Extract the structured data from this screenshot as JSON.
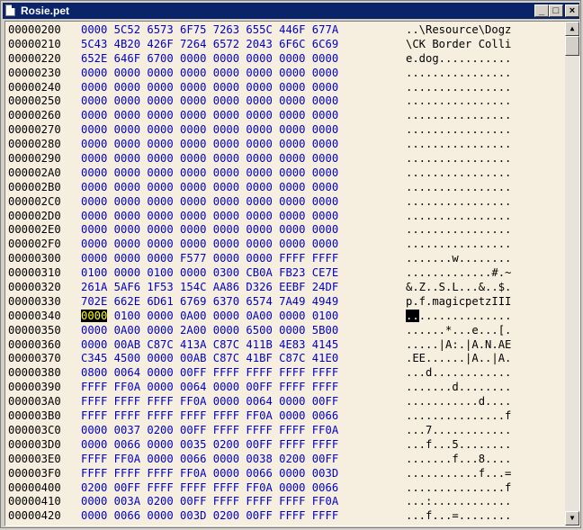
{
  "window": {
    "title": "Rosie.pet"
  },
  "controls": {
    "minimize": "_",
    "maximize": "□",
    "close": "×"
  },
  "scrollbar": {
    "up": "▲",
    "down": "▼"
  },
  "rows": [
    {
      "addr": "00000200",
      "hex": "0000 5C52 6573 6F75 7263 655C 446F 677A",
      "ascii": "..\\Resource\\Dogz"
    },
    {
      "addr": "00000210",
      "hex": "5C43 4B20 426F 7264 6572 2043 6F6C 6C69",
      "ascii": "\\CK Border Colli"
    },
    {
      "addr": "00000220",
      "hex": "652E 646F 6700 0000 0000 0000 0000 0000",
      "ascii": "e.dog..........."
    },
    {
      "addr": "00000230",
      "hex": "0000 0000 0000 0000 0000 0000 0000 0000",
      "ascii": "................"
    },
    {
      "addr": "00000240",
      "hex": "0000 0000 0000 0000 0000 0000 0000 0000",
      "ascii": "................"
    },
    {
      "addr": "00000250",
      "hex": "0000 0000 0000 0000 0000 0000 0000 0000",
      "ascii": "................"
    },
    {
      "addr": "00000260",
      "hex": "0000 0000 0000 0000 0000 0000 0000 0000",
      "ascii": "................"
    },
    {
      "addr": "00000270",
      "hex": "0000 0000 0000 0000 0000 0000 0000 0000",
      "ascii": "................"
    },
    {
      "addr": "00000280",
      "hex": "0000 0000 0000 0000 0000 0000 0000 0000",
      "ascii": "................"
    },
    {
      "addr": "00000290",
      "hex": "0000 0000 0000 0000 0000 0000 0000 0000",
      "ascii": "................"
    },
    {
      "addr": "000002A0",
      "hex": "0000 0000 0000 0000 0000 0000 0000 0000",
      "ascii": "................"
    },
    {
      "addr": "000002B0",
      "hex": "0000 0000 0000 0000 0000 0000 0000 0000",
      "ascii": "................"
    },
    {
      "addr": "000002C0",
      "hex": "0000 0000 0000 0000 0000 0000 0000 0000",
      "ascii": "................"
    },
    {
      "addr": "000002D0",
      "hex": "0000 0000 0000 0000 0000 0000 0000 0000",
      "ascii": "................"
    },
    {
      "addr": "000002E0",
      "hex": "0000 0000 0000 0000 0000 0000 0000 0000",
      "ascii": "................"
    },
    {
      "addr": "000002F0",
      "hex": "0000 0000 0000 0000 0000 0000 0000 0000",
      "ascii": "................"
    },
    {
      "addr": "00000300",
      "hex": "0000 0000 0000 F577 0000 0000 FFFF FFFF",
      "ascii": ".......w........"
    },
    {
      "addr": "00000310",
      "hex": "0100 0000 0100 0000 0300 CB0A FB23 CE7E",
      "ascii": ".............#.~"
    },
    {
      "addr": "00000320",
      "hex": "261A 5AF6 1F53 154C AA86 D326 EEBF 24DF",
      "ascii": "&.Z..S.L...&..$."
    },
    {
      "addr": "00000330",
      "hex": "702E 662E 6D61 6769 6370 6574 7A49 4949",
      "ascii": "p.f.magicpetzIII"
    },
    {
      "addr": "00000340",
      "hexSel": "0000",
      "hex": " 0100 0000 0A00 0000 0A00 0000 0100",
      "asciiSel": "..",
      "ascii": "..............",
      "selected": true
    },
    {
      "addr": "00000350",
      "hex": "0000 0A00 0000 2A00 0000 6500 0000 5B00",
      "ascii": "......*...e...[."
    },
    {
      "addr": "00000360",
      "hex": "0000 00AB C87C 413A C87C 411B 4E83 4145",
      "ascii": ".....|A:.|A.N.AE"
    },
    {
      "addr": "00000370",
      "hex": "C345 4500 0000 00AB C87C 41BF C87C 41E0",
      "ascii": ".EE......|A..|A."
    },
    {
      "addr": "00000380",
      "hex": "0800 0064 0000 00FF FFFF FFFF FFFF FFFF",
      "ascii": "...d............"
    },
    {
      "addr": "00000390",
      "hex": "FFFF FF0A 0000 0064 0000 00FF FFFF FFFF",
      "ascii": ".......d........"
    },
    {
      "addr": "000003A0",
      "hex": "FFFF FFFF FFFF FF0A 0000 0064 0000 00FF",
      "ascii": "...........d...."
    },
    {
      "addr": "000003B0",
      "hex": "FFFF FFFF FFFF FFFF FFFF FF0A 0000 0066",
      "ascii": "...............f"
    },
    {
      "addr": "000003C0",
      "hex": "0000 0037 0200 00FF FFFF FFFF FFFF FF0A",
      "ascii": "...7............"
    },
    {
      "addr": "000003D0",
      "hex": "0000 0066 0000 0035 0200 00FF FFFF FFFF",
      "ascii": "...f...5........"
    },
    {
      "addr": "000003E0",
      "hex": "FFFF FF0A 0000 0066 0000 0038 0200 00FF",
      "ascii": ".......f...8...."
    },
    {
      "addr": "000003F0",
      "hex": "FFFF FFFF FFFF FF0A 0000 0066 0000 003D",
      "ascii": "...........f...="
    },
    {
      "addr": "00000400",
      "hex": "0200 00FF FFFF FFFF FFFF FF0A 0000 0066",
      "ascii": "...............f"
    },
    {
      "addr": "00000410",
      "hex": "0000 003A 0200 00FF FFFF FFFF FFFF FF0A",
      "ascii": "...:............"
    },
    {
      "addr": "00000420",
      "hex": "0000 0066 0000 003D 0200 00FF FFFF FFFF",
      "ascii": "...f...=........"
    }
  ]
}
